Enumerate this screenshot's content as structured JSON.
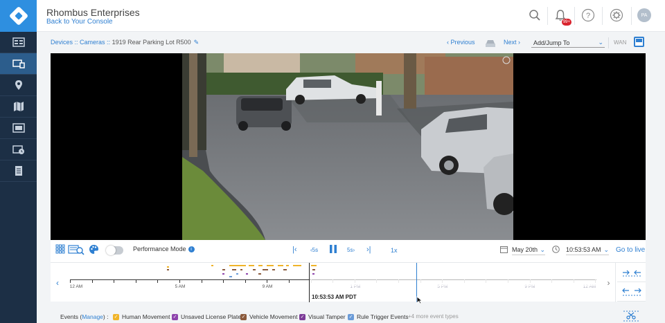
{
  "app": {
    "org_name": "Rhombus Enterprises",
    "back_link": "Back to Your Console",
    "notifications_count": "99+",
    "avatar_initials": "PA"
  },
  "sidebar": {
    "items": [
      {
        "icon": "dashboard-icon"
      },
      {
        "icon": "devices-icon",
        "active": true
      },
      {
        "icon": "location-pin-icon"
      },
      {
        "icon": "map-icon"
      },
      {
        "icon": "video-wall-icon"
      },
      {
        "icon": "recorded-video-icon"
      },
      {
        "icon": "reports-icon"
      }
    ]
  },
  "breadcrumb": {
    "devices": "Devices",
    "sep1": " :: ",
    "cameras": "Cameras",
    "sep2": " :: ",
    "current": "1919 Rear Parking Lot R500"
  },
  "nav": {
    "previous": "Previous",
    "next": "Next",
    "jump_placeholder": "Add/Jump To",
    "wan": "WAN"
  },
  "controls": {
    "performance_mode": "Performance Mode",
    "rewind_label": "5s",
    "forward_label": "5s",
    "speed": "1x",
    "date": "May 20th",
    "time": "10:53:53 AM",
    "go_live": "Go to live"
  },
  "timeline": {
    "ticks": [
      "12 AM",
      "5 AM",
      "9 AM",
      "1 PM",
      "5 PM",
      "9 PM",
      "12 AM"
    ],
    "cursor_time": "10:53:53 AM PDT"
  },
  "events": {
    "label_prefix": "Events (",
    "manage": "Manage",
    "label_suffix": ") :",
    "items": [
      {
        "label": "Human Movement",
        "color": "#f0b429"
      },
      {
        "label": "Unsaved License Plate",
        "color": "#8e44ad"
      },
      {
        "label": "Vehicle Movement",
        "color": "#8b5a3c"
      },
      {
        "label": "Visual Tamper",
        "color": "#7d3c98"
      },
      {
        "label": "Rule Trigger Events",
        "color": "#6a9bd8"
      }
    ],
    "more": "+4 more event types"
  },
  "colors": {
    "accent": "#2e7fd1",
    "sidebar": "#1c2f45",
    "logo_bg": "#2e8fe0"
  }
}
